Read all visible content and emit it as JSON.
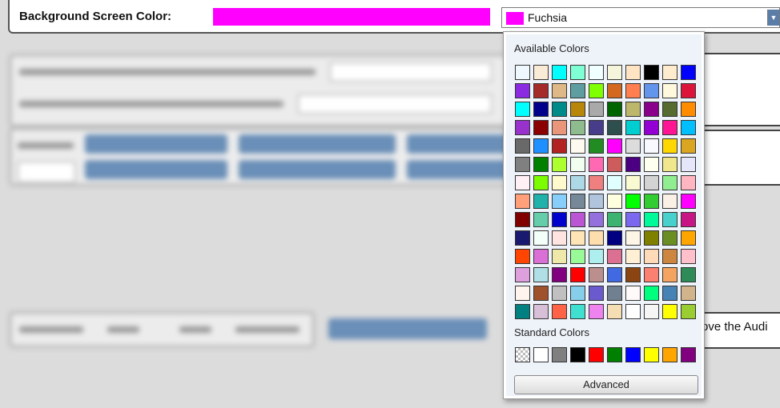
{
  "header": {
    "background_label": "Background Screen Color:",
    "selected_color_hex": "#FF00FF",
    "selected_color_name": "Fuchsia"
  },
  "right_panel": {
    "partial_text": "ove the Audi"
  },
  "dropdown": {
    "available_heading": "Available Colors",
    "standard_heading": "Standard Colors",
    "advanced_label": "Advanced",
    "available_colors": [
      "#F0F8FF",
      "#FAEBD7",
      "#00FFFF",
      "#7FFFD4",
      "#F0FFFF",
      "#F5F5DC",
      "#FFE4C4",
      "#000000",
      "#FFEBCD",
      "#0000FF",
      "#8A2BE2",
      "#A52A2A",
      "#DEB887",
      "#5F9EA0",
      "#7FFF00",
      "#D2691E",
      "#FF7F50",
      "#6495ED",
      "#FFF8DC",
      "#DC143C",
      "#00FFFF",
      "#00008B",
      "#008B8B",
      "#B8860B",
      "#A9A9A9",
      "#006400",
      "#BDB76B",
      "#8B008B",
      "#556B2F",
      "#FF8C00",
      "#9932CC",
      "#8B0000",
      "#E9967A",
      "#8FBC8F",
      "#483D8B",
      "#2F4F4F",
      "#00CED1",
      "#9400D3",
      "#FF1493",
      "#00BFFF",
      "#696969",
      "#1E90FF",
      "#B22222",
      "#FFFAF0",
      "#228B22",
      "#FF00FF",
      "#DCDCDC",
      "#F8F8FF",
      "#FFD700",
      "#DAA520",
      "#808080",
      "#008000",
      "#ADFF2F",
      "#F0FFF0",
      "#FF69B4",
      "#CD5C5C",
      "#4B0082",
      "#FFFFF0",
      "#F0E68C",
      "#E6E6FA",
      "#FFF0F5",
      "#7CFC00",
      "#FFFACD",
      "#ADD8E6",
      "#F08080",
      "#E0FFFF",
      "#FAFAD2",
      "#D3D3D3",
      "#90EE90",
      "#FFB6C1",
      "#FFA07A",
      "#20B2AA",
      "#87CEFA",
      "#778899",
      "#B0C4DE",
      "#FFFFE0",
      "#00FF00",
      "#32CD32",
      "#FAF0E6",
      "#FF00FF",
      "#800000",
      "#66CDAA",
      "#0000CD",
      "#BA55D3",
      "#9370DB",
      "#3CB371",
      "#7B68EE",
      "#00FA9A",
      "#48D1CC",
      "#C71585",
      "#191970",
      "#F5FFFA",
      "#FFE4E1",
      "#FFE4B5",
      "#FFDEAD",
      "#000080",
      "#FDF5E6",
      "#808000",
      "#6B8E23",
      "#FFA500",
      "#FF4500",
      "#DA70D6",
      "#EEE8AA",
      "#98FB98",
      "#AFEEEE",
      "#DB7093",
      "#FFEFD5",
      "#FFDAB9",
      "#CD853F",
      "#FFC0CB",
      "#DDA0DD",
      "#B0E0E6",
      "#800080",
      "#FF0000",
      "#BC8F8F",
      "#4169E1",
      "#8B4513",
      "#FA8072",
      "#F4A460",
      "#2E8B57",
      "#FFF5EE",
      "#A0522D",
      "#C0C0C0",
      "#87CEEB",
      "#6A5ACD",
      "#708090",
      "#FFFAFA",
      "#00FF7F",
      "#4682B4",
      "#D2B48C",
      "#008080",
      "#D8BFD8",
      "#FF6347",
      "#40E0D0",
      "#EE82EE",
      "#F5DEB3",
      "#FFFFFF",
      "#F5F5F5",
      "#FFFF00",
      "#9ACD32"
    ],
    "standard_colors": [
      "transparent",
      "#FFFFFF",
      "#808080",
      "#000000",
      "#FF0000",
      "#008000",
      "#0000FF",
      "#FFFF00",
      "#FFA500",
      "#800080"
    ]
  }
}
